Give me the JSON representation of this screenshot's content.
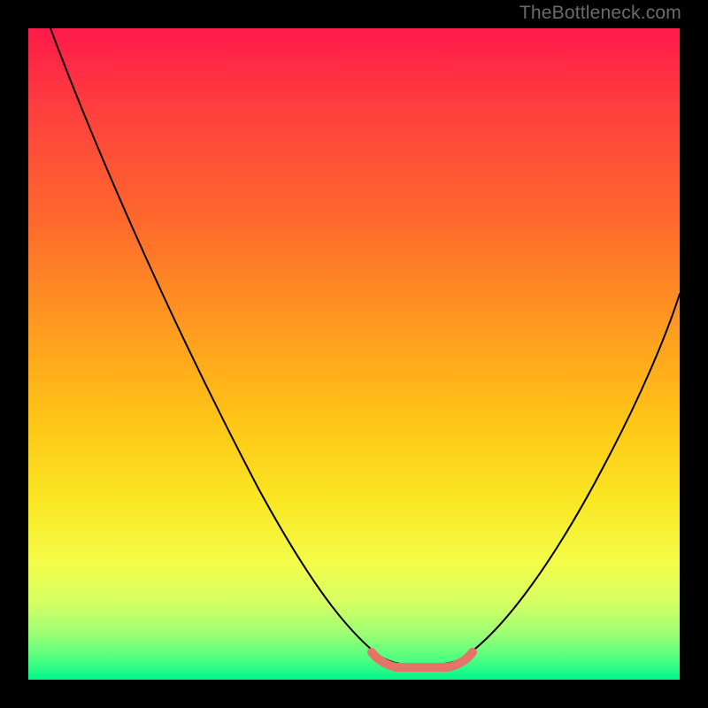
{
  "watermark": "TheBottleneck.com",
  "chart_data": {
    "type": "line",
    "title": "",
    "xlabel": "",
    "ylabel": "",
    "xlim": [
      0,
      100
    ],
    "ylim": [
      0,
      100
    ],
    "series": [
      {
        "name": "bottleneck-curve",
        "x": [
          0,
          6,
          12,
          18,
          24,
          30,
          36,
          42,
          48,
          52,
          55,
          58,
          61,
          64,
          67,
          72,
          78,
          84,
          90,
          96,
          100
        ],
        "values": [
          100,
          90,
          79,
          68,
          56,
          45,
          34,
          23,
          12,
          5,
          2,
          1,
          1,
          2,
          5,
          12,
          23,
          34,
          45,
          56,
          63
        ]
      },
      {
        "name": "ideal-zone-highlight",
        "x": [
          51,
          53,
          56,
          59,
          62,
          65,
          67
        ],
        "values": [
          4,
          2,
          1,
          1,
          1,
          2,
          4
        ]
      }
    ],
    "background_gradient_stops": [
      {
        "position": 0.0,
        "color": "#FF1A4B"
      },
      {
        "position": 0.3,
        "color": "#FF6A2C"
      },
      {
        "position": 0.6,
        "color": "#FFC416"
      },
      {
        "position": 0.82,
        "color": "#F3FC48"
      },
      {
        "position": 1.0,
        "color": "#00F58B"
      }
    ]
  }
}
